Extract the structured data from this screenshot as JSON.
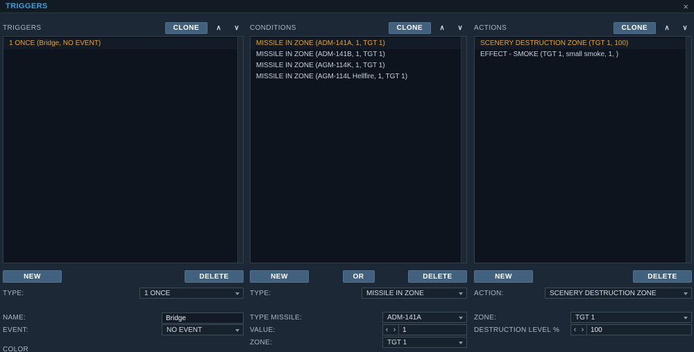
{
  "titlebar": {
    "title": "TRIGGERS",
    "close": "×"
  },
  "icons": {
    "up_arrow": "∧",
    "down_arrow": "∨",
    "stepper_left": "‹",
    "stepper_right": "›"
  },
  "colors": {
    "accent_title": "#3f9fd8",
    "selected_item_text": "#e2a23b",
    "button_bg": "#42617e",
    "list_bg": "#0d141d",
    "panel_bg": "#1d2836"
  },
  "panels": {
    "triggers": {
      "header": "TRIGGERS",
      "clone": "CLONE",
      "items": [
        "1 ONCE (Bridge, NO EVENT)"
      ],
      "selected_index": 0,
      "buttons": {
        "new": "NEW",
        "delete": "DELETE"
      },
      "form": {
        "type_label": "TYPE:",
        "type_value": "1 ONCE",
        "name_label": "NAME:",
        "name_value": "Bridge",
        "event_label": "EVENT:",
        "event_value": "NO EVENT",
        "color_label": "COLOR"
      }
    },
    "conditions": {
      "header": "CONDITIONS",
      "clone": "CLONE",
      "items": [
        "MISSILE IN ZONE (ADM-141A, 1, TGT 1)",
        "MISSILE IN ZONE (ADM-141B, 1, TGT 1)",
        "MISSILE IN ZONE (AGM-114K, 1, TGT 1)",
        "MISSILE IN ZONE (AGM-114L Hellfire, 1, TGT 1)"
      ],
      "selected_index": 0,
      "buttons": {
        "new": "NEW",
        "or": "OR",
        "delete": "DELETE"
      },
      "form": {
        "type_label": "TYPE:",
        "type_value": "MISSILE IN ZONE",
        "missile_label": "TYPE MISSILE:",
        "missile_value": "ADM-141A",
        "value_label": "VALUE:",
        "value_value": "1",
        "zone_label": "ZONE:",
        "zone_value": "TGT 1"
      }
    },
    "actions": {
      "header": "ACTIONS",
      "clone": "CLONE",
      "items": [
        "SCENERY DESTRUCTION ZONE (TGT 1, 100)",
        "EFFECT - SMOKE (TGT 1, small smoke, 1, )"
      ],
      "selected_index": 0,
      "buttons": {
        "new": "NEW",
        "delete": "DELETE"
      },
      "form": {
        "action_label": "ACTION:",
        "action_value": "SCENERY DESTRUCTION ZONE",
        "zone_label": "ZONE:",
        "zone_value": "TGT 1",
        "destruction_label": "DESTRUCTION LEVEL %",
        "destruction_value": "100"
      }
    }
  }
}
